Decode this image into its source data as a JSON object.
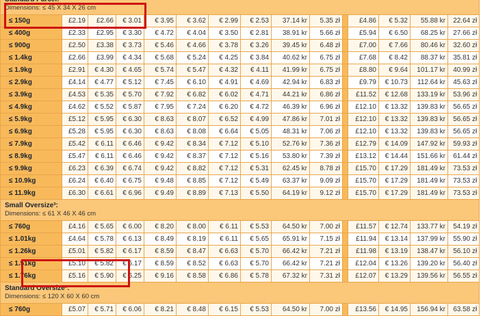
{
  "sections": [
    {
      "title": "Standard Parcel:",
      "dimensions": "Dimensions: ≤ 45 X 34 X 26 cm",
      "highlighted": true,
      "rows": [
        {
          "weight": "≤ 150g",
          "values": [
            "£2.19",
            "£2.66",
            "€ 3.01",
            "€ 3.95",
            "€ 3.62",
            "€ 2.99",
            "€ 2.53",
            "37.14 kr",
            "5.35 zł",
            "£4.86",
            "€ 5.32",
            "55.88 kr",
            "22.64 zł"
          ]
        },
        {
          "weight": "≤ 400g",
          "values": [
            "£2.33",
            "£2.95",
            "€ 3.30",
            "€ 4.72",
            "€ 4.04",
            "€ 3.50",
            "€ 2.81",
            "38.91 kr",
            "5.66 zł",
            "£5.94",
            "€ 6.50",
            "68.25 kr",
            "27.66 zł"
          ]
        },
        {
          "weight": "≤ 900g",
          "values": [
            "£2.50",
            "£3.38",
            "€ 3.73",
            "€ 5.46",
            "€ 4.66",
            "€ 3.78",
            "€ 3.26",
            "39.45 kr",
            "6.48 zł",
            "£7.00",
            "€ 7.66",
            "80.46 kr",
            "32.60 zł"
          ]
        },
        {
          "weight": "≤ 1.4kg",
          "values": [
            "£2.66",
            "£3.99",
            "€ 4.34",
            "€ 5.68",
            "€ 5.24",
            "€ 4.25",
            "€ 3.84",
            "40.62 kr",
            "6.75 zł",
            "£7.68",
            "€ 8.42",
            "88.37 kr",
            "35.81 zł"
          ]
        },
        {
          "weight": "≤ 1.9kg",
          "values": [
            "£2.91",
            "€ 4.30",
            "€ 4.65",
            "€ 5.74",
            "€ 5.47",
            "€ 4.32",
            "€ 4.11",
            "41.99 kr",
            "6.75 zł",
            "£8.80",
            "€ 9.64",
            "101.17 kr",
            "40.99 zł"
          ]
        },
        {
          "weight": "≤ 2.9kg",
          "values": [
            "£4.14",
            "€ 4.77",
            "€ 5.12",
            "€ 7.45",
            "€ 6.10",
            "€ 4.91",
            "€ 4.69",
            "42.94 kr",
            "6.83 zł",
            "£9.79",
            "€ 10.73",
            "112.64 kr",
            "45.63 zł"
          ]
        },
        {
          "weight": "≤ 3.9kg",
          "values": [
            "£4.53",
            "€ 5.35",
            "€ 5.70",
            "€ 7.92",
            "€ 6.82",
            "€ 6.02",
            "€ 4.71",
            "44.21 kr",
            "6.86 zł",
            "£11.52",
            "€ 12.68",
            "133.19 kr",
            "53.96 zł"
          ]
        },
        {
          "weight": "≤ 4.9kg",
          "values": [
            "£4.62",
            "€ 5.52",
            "€ 5.87",
            "€ 7.95",
            "€ 7.24",
            "€ 6.20",
            "€ 4.72",
            "46.39 kr",
            "6.96 zł",
            "£12.10",
            "€ 13.32",
            "139.83 kr",
            "56.65 zł"
          ]
        },
        {
          "weight": "≤ 5.9kg",
          "values": [
            "£5.12",
            "€ 5.95",
            "€ 6.30",
            "€ 8.63",
            "€ 8.07",
            "€ 6.52",
            "€ 4.99",
            "47.86 kr",
            "7.01 zł",
            "£12.10",
            "€ 13.32",
            "139.83 kr",
            "56.65 zł"
          ]
        },
        {
          "weight": "≤ 6.9kg",
          "values": [
            "£5.28",
            "€ 5.95",
            "€ 6.30",
            "€ 8.63",
            "€ 8.08",
            "€ 6.64",
            "€ 5.05",
            "48.31 kr",
            "7.06 zł",
            "£12.10",
            "€ 13.32",
            "139.83 kr",
            "56.65 zł"
          ]
        },
        {
          "weight": "≤ 7.9kg",
          "values": [
            "£5.42",
            "€ 6.11",
            "€ 6.46",
            "€ 9.42",
            "€ 8.34",
            "€ 7.12",
            "€ 5.10",
            "52.76 kr",
            "7.36 zł",
            "£12.79",
            "€ 14.09",
            "147.92 kr",
            "59.93 zł"
          ]
        },
        {
          "weight": "≤ 8.9kg",
          "values": [
            "£5.47",
            "€ 6.11",
            "€ 6.46",
            "€ 9.42",
            "€ 8.37",
            "€ 7.12",
            "€ 5.16",
            "53.80 kr",
            "7.39 zł",
            "£13.12",
            "€ 14.44",
            "151.66 kr",
            "61.44 zł"
          ]
        },
        {
          "weight": "≤ 9.9kg",
          "values": [
            "£6.23",
            "€ 6.39",
            "€ 6.74",
            "€ 9.42",
            "€ 8.82",
            "€ 7.12",
            "€ 5.31",
            "62.45 kr",
            "8.78 zł",
            "£15.70",
            "€ 17.29",
            "181.49 kr",
            "73.53 zł"
          ]
        },
        {
          "weight": "≤ 10.9kg",
          "values": [
            "£6.24",
            "€ 6.40",
            "€ 6.75",
            "€ 9.48",
            "€ 8.85",
            "€ 7.12",
            "€ 5.49",
            "63.37 kr",
            "9.09 zł",
            "£15.70",
            "€ 17.29",
            "181.49 kr",
            "73.53 zł"
          ]
        },
        {
          "weight": "≤ 11.9kg",
          "values": [
            "£6.30",
            "€ 6.61",
            "€ 6.96",
            "€ 9.49",
            "€ 8.89",
            "€ 7.13",
            "€ 5.50",
            "64.19 kr",
            "9.12 zł",
            "£15.70",
            "€ 17.29",
            "181.49 kr",
            "73.53 zł"
          ]
        }
      ]
    },
    {
      "title": "Small Oversize³:",
      "dimensions": "Dimensions: ≤ 61 X 46 X 46 cm",
      "highlighted": false,
      "rows": [
        {
          "weight": "≤ 760g",
          "values": [
            "£4.16",
            "€ 5.65",
            "€ 6.00",
            "€ 8.20",
            "€ 8.00",
            "€ 6.11",
            "€ 5.53",
            "64.50 kr",
            "7.00 zł",
            "£11.57",
            "€ 12.74",
            "133.77 kr",
            "54.19 zł"
          ]
        },
        {
          "weight": "≤ 1.01kg",
          "values": [
            "£4.64",
            "€ 5.78",
            "€ 6.13",
            "€ 8.49",
            "€ 8.19",
            "€ 6.11",
            "€ 5.65",
            "65.91 kr",
            "7.15 zł",
            "£11.94",
            "€ 13.14",
            "137.99 kr",
            "55.90 zł"
          ]
        },
        {
          "weight": "≤ 1.26kg",
          "values": [
            "£5.01",
            "€ 5.82",
            "€ 6.17",
            "€ 8.59",
            "€ 8.47",
            "€ 6.63",
            "€ 5.70",
            "66.42 kr",
            "7.21 zł",
            "£11.98",
            "€ 13.19",
            "138.47 kr",
            "56.10 zł"
          ]
        },
        {
          "weight": "≤ 1.51kg",
          "values": [
            "£5.10",
            "€ 5.82",
            "€ 6.17",
            "€ 8.59",
            "€ 8.52",
            "€ 6.63",
            "€ 5.70",
            "66.42 kr",
            "7.21 zł",
            "£12.04",
            "€ 13.26",
            "139.20 kr",
            "56.40 zł"
          ]
        },
        {
          "weight": "≤ 1.76kg",
          "values": [
            "£5.16",
            "€ 5.90",
            "€ 6.25",
            "€ 9.16",
            "€ 8.58",
            "€ 6.86",
            "€ 5.78",
            "67.32 kr",
            "7.31 zł",
            "£12.07",
            "€ 13.29",
            "139.56 kr",
            "56.55 zł"
          ]
        }
      ]
    },
    {
      "title": "Standard Oversize³:",
      "dimensions": "Dimensions: ≤ 120 X 60 X 60 cm",
      "highlighted": true,
      "rows": [
        {
          "weight": "≤ 760g",
          "values": [
            "£5.07",
            "€ 5.71",
            "€ 6.06",
            "€ 8.21",
            "€ 8.48",
            "€ 6.15",
            "€ 5.53",
            "64.50 kr",
            "7.00 zł",
            "£13.56",
            "€ 14.95",
            "156.94 kr",
            "63.58 zł"
          ]
        }
      ]
    }
  ],
  "colors": {
    "header_orange": "#f8b95a",
    "section_orange": "#fbc779",
    "row_tint": "#fff8ea",
    "border": "#e7a64a",
    "highlight": "#cc1111"
  }
}
